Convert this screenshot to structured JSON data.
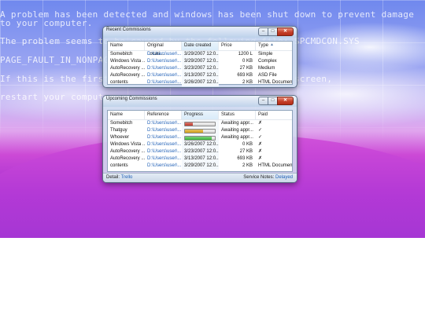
{
  "desktop": {
    "lines": [
      "A problem has been detected and windows has been shut down to prevent damage",
      "to your computer.",
      "The problem seems to be caused by the following file: SPCMDCON.SYS",
      "PAGE_FAULT_IN_NONPAGED_AREA",
      "If this is the first time you've seen this stop error screen,",
      "restart your computer."
    ]
  },
  "recent": {
    "title": "Recent Commissions",
    "columns": [
      "Name",
      "Original Locati...",
      "Date created",
      "Price",
      "Type"
    ],
    "rows": [
      {
        "name": "Somebitch",
        "location": "D:\\Users\\user\\...",
        "date": "3/29/2007 12:0...",
        "price": "1200 L",
        "type": "Simple"
      },
      {
        "name": "Windows Vista ...",
        "location": "D:\\Users\\user\\...",
        "date": "3/29/2007 12:0...",
        "price": "0 KB",
        "type": "Complex"
      },
      {
        "name": "AutoRecovery ...",
        "location": "D:\\Users\\user\\...",
        "date": "3/23/2007 12:0...",
        "price": "27 KB",
        "type": "Medium"
      },
      {
        "name": "AutoRecovery ...",
        "location": "D:\\Users\\user\\...",
        "date": "3/13/2007 12:0...",
        "price": "693 KB",
        "type": "ASD File"
      },
      {
        "name": "contents",
        "location": "D:\\Users\\user\\...",
        "date": "3/26/2007 12:0...",
        "price": "2 KB",
        "type": "HTML Document"
      }
    ]
  },
  "upcoming": {
    "title": "Upcoming Commissions",
    "columns": [
      "Name",
      "Reference",
      "Progress",
      "Status",
      "Paid"
    ],
    "rows": [
      {
        "name": "Somebitch",
        "ref": "D:\\Users\\user\\...",
        "progress": 0.25,
        "color": "#c0392b",
        "status": "Awaiting appr...",
        "paid": "✗"
      },
      {
        "name": "Thatguy",
        "ref": "D:\\Users\\user\\...",
        "progress": 0.6,
        "color": "#d4a017",
        "status": "Awaiting appr...",
        "paid": "✓"
      },
      {
        "name": "Whoever",
        "ref": "D:\\Users\\user\\...",
        "progress": 0.9,
        "color": "#3db83d",
        "status": "Awaiting appr...",
        "paid": "✓"
      },
      {
        "name": "Windows Vista ...",
        "ref": "D:\\Users\\user\\...",
        "date": "3/26/2007 12:0...",
        "status": "0 KB",
        "paid": "✗"
      },
      {
        "name": "AutoRecovery ...",
        "ref": "D:\\Users\\user\\...",
        "date": "3/23/2007 12:0...",
        "status": "27 KB",
        "paid": "✗"
      },
      {
        "name": "AutoRecovery ...",
        "ref": "D:\\Users\\user\\...",
        "date": "3/13/2007 12:0...",
        "status": "693 KB",
        "paid": "✗"
      },
      {
        "name": "contents",
        "ref": "D:\\Users\\user\\...",
        "date": "3/29/2007 12:0...",
        "status": "2 KB",
        "paid": "HTML Document"
      }
    ],
    "status_left_label": "Detail:",
    "status_left_value": "Trello",
    "status_right_label": "Service Notes:",
    "status_right_value": "Delayed"
  }
}
